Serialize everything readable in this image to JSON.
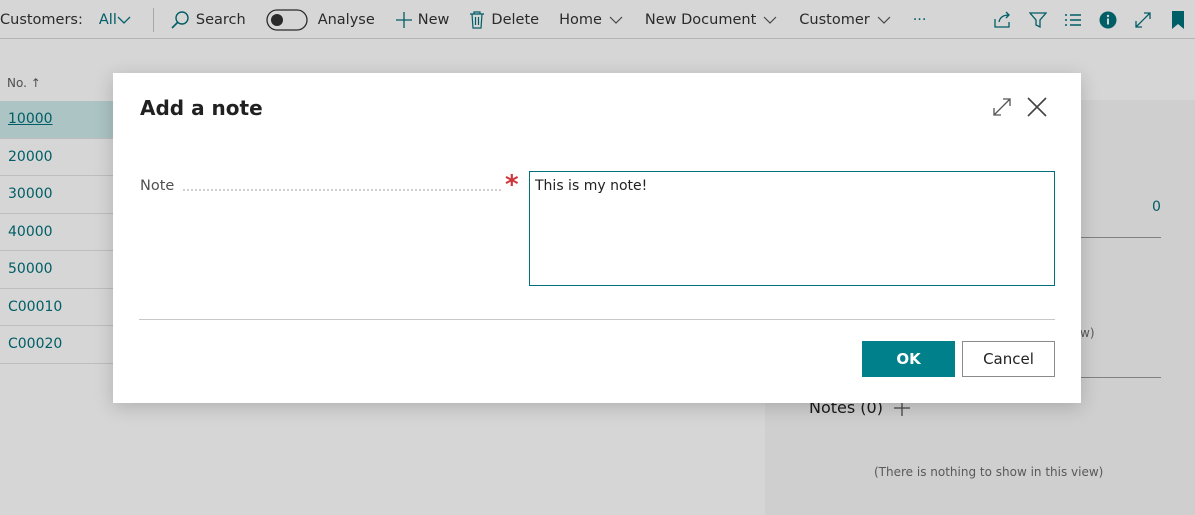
{
  "toolbar": {
    "title": "Customers:",
    "filter": "All",
    "search": "Search",
    "analyse": "Analyse",
    "new": "New",
    "delete": "Delete",
    "home": "Home",
    "new_document": "New Document",
    "customer": "Customer",
    "more": "···"
  },
  "list": {
    "header": "No.",
    "sort_indicator": "↑",
    "rows": [
      "10000",
      "20000",
      "30000",
      "40000",
      "50000",
      "C00010",
      "C00020"
    ]
  },
  "factbox": {
    "value": "0",
    "partial_text": "w)",
    "notes_label": "Notes (0)",
    "empty_text": "(There is nothing to show in this view)"
  },
  "dialog": {
    "title": "Add a note",
    "field_label": "Note",
    "note_value": "This is my note!",
    "ok_label": "OK",
    "cancel_label": "Cancel"
  },
  "colors": {
    "accent": "#00707a",
    "ok_button": "#00808a",
    "required": "#d13438",
    "selected_row": "#cdeaea"
  },
  "icons": [
    "search-icon",
    "toggle-switch",
    "plus-icon",
    "trash-icon",
    "chevron-down-icon",
    "share-icon",
    "filter-icon",
    "list-icon",
    "info-icon",
    "expand-icon",
    "bookmark-icon",
    "close-icon"
  ]
}
